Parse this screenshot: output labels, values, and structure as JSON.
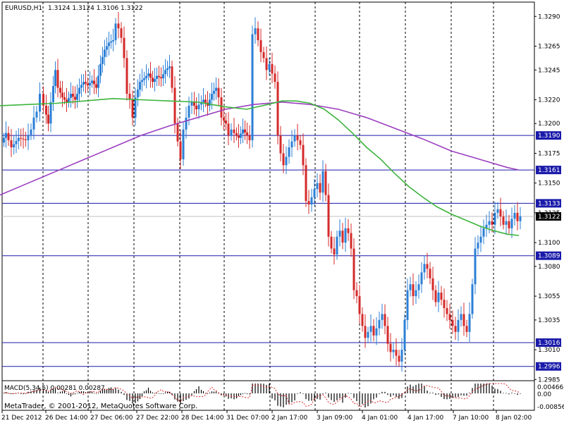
{
  "header": {
    "symbol": "EURUSD,H1",
    "ohlc": "1.3124 1.3124 1.3106 1.3122"
  },
  "macd": {
    "label": "MACD(5,34,5) 0.00281 0.00287",
    "scale_top": "0.00466",
    "scale_zero": "0.00",
    "scale_bottom": "-0.00856"
  },
  "footer": {
    "copyright": "MetaTrader, © 2001-2012, MetaQuotes Software Corp."
  },
  "colors": {
    "bull": "#2b7fd6",
    "bear": "#d42a2a",
    "ma_fast": "#3cb43c",
    "ma_slow": "#9b3fbf",
    "level": "#1a1aaa",
    "current": "#c0c0c0",
    "grid": "#000000"
  },
  "chart_data": {
    "type": "candlestick",
    "ylim": [
      1.2984,
      1.3302
    ],
    "y_ticks": [
      "1.3290",
      "1.3265",
      "1.3245",
      "1.3220",
      "1.3200",
      "1.3175",
      "1.3150",
      "1.3125",
      "1.3100",
      "1.3080",
      "1.3055",
      "1.3035",
      "1.3010",
      "1.2985"
    ],
    "x_ticks": [
      "21 Dec 2012",
      "26 Dec 14:00",
      "27 Dec 06:00",
      "27 Dec 22:00",
      "28 Dec 14:00",
      "31 Dec 07:00",
      "2 Jan 17:00",
      "3 Jan 09:00",
      "4 Jan 01:00",
      "4 Jan 17:00",
      "7 Jan 10:00",
      "8 Jan 02:00"
    ],
    "horizontal_levels": [
      "1.3190",
      "1.3161",
      "1.3133",
      "1.3089",
      "1.3016",
      "1.2996"
    ],
    "current_price": "1.3122",
    "price_path": [
      [
        0,
        1.3184
      ],
      [
        6,
        1.3192
      ],
      [
        14,
        1.318
      ],
      [
        24,
        1.3188
      ],
      [
        34,
        1.3186
      ],
      [
        42,
        1.3195
      ],
      [
        46,
        1.3205
      ],
      [
        50,
        1.321
      ],
      [
        55,
        1.3225
      ],
      [
        60,
        1.3215
      ],
      [
        66,
        1.32
      ],
      [
        70,
        1.3218
      ],
      [
        76,
        1.3245
      ],
      [
        80,
        1.323
      ],
      [
        86,
        1.3222
      ],
      [
        92,
        1.3218
      ],
      [
        98,
        1.3225
      ],
      [
        104,
        1.322
      ],
      [
        110,
        1.323
      ],
      [
        116,
        1.3235
      ],
      [
        122,
        1.3232
      ],
      [
        128,
        1.3236
      ],
      [
        134,
        1.323
      ],
      [
        140,
        1.325
      ],
      [
        146,
        1.3262
      ],
      [
        152,
        1.3268
      ],
      [
        158,
        1.327
      ],
      [
        162,
        1.3284
      ],
      [
        166,
        1.328
      ],
      [
        170,
        1.3272
      ],
      [
        174,
        1.3255
      ],
      [
        178,
        1.3225
      ],
      [
        182,
        1.322
      ],
      [
        186,
        1.3205
      ],
      [
        190,
        1.3222
      ],
      [
        196,
        1.3235
      ],
      [
        202,
        1.3238
      ],
      [
        208,
        1.3242
      ],
      [
        214,
        1.3235
      ],
      [
        220,
        1.324
      ],
      [
        226,
        1.3238
      ],
      [
        232,
        1.3245
      ],
      [
        238,
        1.3248
      ],
      [
        242,
        1.323
      ],
      [
        246,
        1.32
      ],
      [
        250,
        1.3185
      ],
      [
        254,
        1.317
      ],
      [
        258,
        1.3195
      ],
      [
        262,
        1.3205
      ],
      [
        266,
        1.3215
      ],
      [
        270,
        1.3218
      ],
      [
        276,
        1.3212
      ],
      [
        280,
        1.3216
      ],
      [
        286,
        1.322
      ],
      [
        292,
        1.3215
      ],
      [
        298,
        1.3225
      ],
      [
        304,
        1.323
      ],
      [
        308,
        1.3222
      ],
      [
        312,
        1.3205
      ],
      [
        318,
        1.32
      ],
      [
        322,
        1.319
      ],
      [
        326,
        1.3195
      ],
      [
        330,
        1.3192
      ],
      [
        336,
        1.3188
      ],
      [
        342,
        1.3195
      ],
      [
        348,
        1.319
      ],
      [
        352,
        1.3186
      ],
      [
        356,
        1.3275
      ],
      [
        360,
        1.328
      ],
      [
        364,
        1.327
      ],
      [
        368,
        1.326
      ],
      [
        372,
        1.3255
      ],
      [
        376,
        1.3245
      ],
      [
        380,
        1.325
      ],
      [
        384,
        1.3242
      ],
      [
        388,
        1.3235
      ],
      [
        392,
        1.319
      ],
      [
        396,
        1.3175
      ],
      [
        400,
        1.3165
      ],
      [
        404,
        1.3172
      ],
      [
        408,
        1.318
      ],
      [
        412,
        1.3185
      ],
      [
        416,
        1.319
      ],
      [
        420,
        1.3186
      ],
      [
        424,
        1.3182
      ],
      [
        428,
        1.3165
      ],
      [
        432,
        1.3135
      ],
      [
        436,
        1.3132
      ],
      [
        440,
        1.3138
      ],
      [
        444,
        1.3145
      ],
      [
        448,
        1.315
      ],
      [
        452,
        1.3142
      ],
      [
        456,
        1.316
      ],
      [
        460,
        1.314
      ],
      [
        464,
        1.3105
      ],
      [
        468,
        1.3095
      ],
      [
        472,
        1.309
      ],
      [
        476,
        1.3105
      ],
      [
        480,
        1.311
      ],
      [
        484,
        1.31
      ],
      [
        488,
        1.3112
      ],
      [
        492,
        1.3108
      ],
      [
        496,
        1.3095
      ],
      [
        500,
        1.306
      ],
      [
        504,
        1.3055
      ],
      [
        508,
        1.304
      ],
      [
        512,
        1.303
      ],
      [
        516,
        1.302
      ],
      [
        520,
        1.3025
      ],
      [
        524,
        1.303
      ],
      [
        528,
        1.3022
      ],
      [
        532,
        1.3028
      ],
      [
        536,
        1.3035
      ],
      [
        540,
        1.304
      ],
      [
        544,
        1.303
      ],
      [
        548,
        1.3015
      ],
      [
        552,
        1.3008
      ],
      [
        556,
        1.301
      ],
      [
        560,
        1.3005
      ],
      [
        564,
        1.3
      ],
      [
        568,
        1.301
      ],
      [
        572,
        1.3035
      ],
      [
        576,
        1.306
      ],
      [
        580,
        1.3065
      ],
      [
        584,
        1.3055
      ],
      [
        588,
        1.306
      ],
      [
        592,
        1.3065
      ],
      [
        596,
        1.3075
      ],
      [
        600,
        1.3082
      ],
      [
        604,
        1.3078
      ],
      [
        608,
        1.307
      ],
      [
        612,
        1.306
      ],
      [
        616,
        1.305
      ],
      [
        620,
        1.3058
      ],
      [
        624,
        1.3052
      ],
      [
        628,
        1.3045
      ],
      [
        632,
        1.304
      ],
      [
        636,
        1.3035
      ],
      [
        640,
        1.303
      ],
      [
        644,
        1.3025
      ],
      [
        648,
        1.3035
      ],
      [
        652,
        1.304
      ],
      [
        656,
        1.303
      ],
      [
        660,
        1.3025
      ],
      [
        664,
        1.304
      ],
      [
        668,
        1.3065
      ],
      [
        672,
        1.3095
      ],
      [
        676,
        1.31
      ],
      [
        680,
        1.3105
      ],
      [
        684,
        1.3112
      ],
      [
        688,
        1.3115
      ],
      [
        692,
        1.3118
      ],
      [
        696,
        1.3115
      ],
      [
        700,
        1.3125
      ],
      [
        704,
        1.3128
      ],
      [
        708,
        1.3122
      ],
      [
        712,
        1.3115
      ],
      [
        716,
        1.3118
      ],
      [
        720,
        1.3112
      ],
      [
        724,
        1.312
      ],
      [
        728,
        1.3125
      ],
      [
        732,
        1.3118
      ],
      [
        736,
        1.3122
      ]
    ],
    "ma_fast_path": [
      [
        0,
        1.3215
      ],
      [
        40,
        1.3216
      ],
      [
        80,
        1.3217
      ],
      [
        120,
        1.3219
      ],
      [
        160,
        1.3221
      ],
      [
        200,
        1.322
      ],
      [
        240,
        1.3219
      ],
      [
        280,
        1.3218
      ],
      [
        320,
        1.3214
      ],
      [
        350,
        1.3212
      ],
      [
        380,
        1.3216
      ],
      [
        400,
        1.3219
      ],
      [
        420,
        1.3219
      ],
      [
        440,
        1.3217
      ],
      [
        460,
        1.3212
      ],
      [
        480,
        1.3203
      ],
      [
        500,
        1.3192
      ],
      [
        520,
        1.318
      ],
      [
        540,
        1.317
      ],
      [
        560,
        1.3158
      ],
      [
        580,
        1.3147
      ],
      [
        600,
        1.3138
      ],
      [
        620,
        1.313
      ],
      [
        640,
        1.3124
      ],
      [
        660,
        1.3119
      ],
      [
        680,
        1.3114
      ],
      [
        700,
        1.311
      ],
      [
        720,
        1.3107
      ],
      [
        736,
        1.3106
      ]
    ],
    "ma_slow_path": [
      [
        0,
        1.314
      ],
      [
        40,
        1.315
      ],
      [
        80,
        1.316
      ],
      [
        120,
        1.317
      ],
      [
        160,
        1.318
      ],
      [
        200,
        1.319
      ],
      [
        240,
        1.3198
      ],
      [
        280,
        1.3205
      ],
      [
        320,
        1.3212
      ],
      [
        360,
        1.3216
      ],
      [
        400,
        1.3218
      ],
      [
        440,
        1.3216
      ],
      [
        480,
        1.3212
      ],
      [
        520,
        1.3205
      ],
      [
        560,
        1.3196
      ],
      [
        600,
        1.3187
      ],
      [
        640,
        1.3177
      ],
      [
        680,
        1.317
      ],
      [
        720,
        1.3163
      ],
      [
        736,
        1.3161
      ]
    ]
  }
}
